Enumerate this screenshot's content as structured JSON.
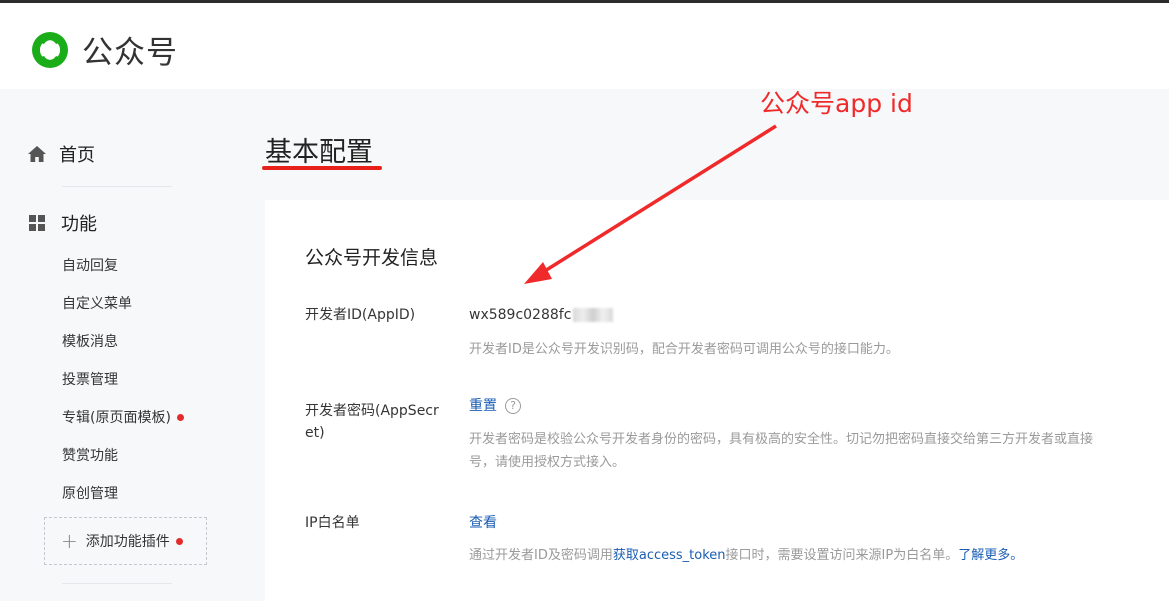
{
  "header": {
    "title": "公众号",
    "logo_icon": "wechat-mp-logo-icon"
  },
  "sidebar": {
    "home": {
      "label": "首页",
      "icon": "home-icon"
    },
    "features": {
      "label": "功能",
      "icon": "grid-icon"
    },
    "items": [
      {
        "label": "自动回复",
        "dot": false
      },
      {
        "label": "自定义菜单",
        "dot": false
      },
      {
        "label": "模板消息",
        "dot": false
      },
      {
        "label": "投票管理",
        "dot": false
      },
      {
        "label": "专辑(原页面模板)",
        "dot": true
      },
      {
        "label": "赞赏功能",
        "dot": false
      },
      {
        "label": "原创管理",
        "dot": false
      }
    ],
    "add_plugin": {
      "label": "添加功能插件",
      "dot": true
    }
  },
  "main": {
    "page_title": "基本配置",
    "annotation": "公众号app id",
    "section_title": "公众号开发信息",
    "appid": {
      "label": "开发者ID(AppID)",
      "value": "wx589c0288fc",
      "desc": "开发者ID是公众号开发识别码，配合开发者密码可调用公众号的接口能力。"
    },
    "appsecret": {
      "label": "开发者密码(AppSecret)",
      "action": "重置",
      "help": "?",
      "desc_line1": "开发者密码是校验公众号开发者身份的密码，具有极高的安全性。切记勿把密码直接交给第三方开发者或直接",
      "desc_line2": "号，请使用授权方式接入。"
    },
    "ip_whitelist": {
      "label": "IP白名单",
      "action": "查看",
      "desc_pre": "通过开发者ID及密码调用",
      "desc_link1": "获取access_token",
      "desc_mid": "接口时，需要设置访问来源IP为白名单。",
      "desc_link2": "了解更多。"
    }
  },
  "colors": {
    "accent_red": "#e8201a",
    "link": "#1a5db4",
    "wechat_green": "#1aad19"
  }
}
